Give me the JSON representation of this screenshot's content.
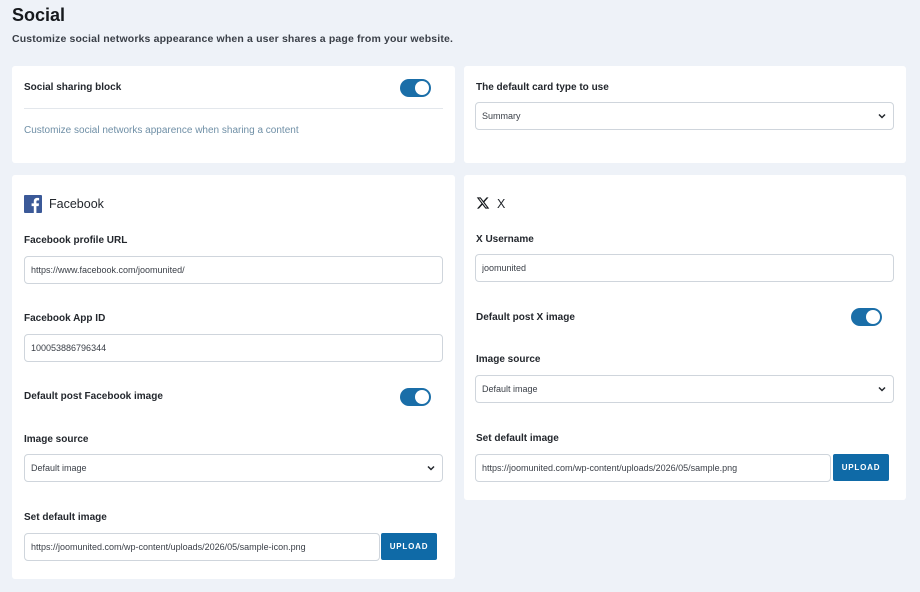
{
  "header": {
    "title": "Social",
    "subtitle": "Customize social networks appearance when a user shares a page from your website."
  },
  "sharing": {
    "label": "Social sharing block",
    "enabled": true,
    "hint": "Customize social networks apparence when sharing a content"
  },
  "card_type": {
    "label": "The default card type to use",
    "selected": "Summary"
  },
  "facebook": {
    "title": "Facebook",
    "profile_url_label": "Facebook profile URL",
    "profile_url_value": "https://www.facebook.com/joomunited/",
    "app_id_label": "Facebook App ID",
    "app_id_value": "100053886796344",
    "default_image_toggle_label": "Default post Facebook image",
    "default_image_enabled": true,
    "image_source_label": "Image source",
    "image_source_selected": "Default image",
    "set_default_image_label": "Set default image",
    "default_image_url": "https://joomunited.com/wp-content/uploads/2026/05/sample-icon.png",
    "upload_label": "UPLOAD"
  },
  "x": {
    "title": "X",
    "username_label": "X Username",
    "username_value": "joomunited",
    "default_image_toggle_label": "Default post X image",
    "default_image_enabled": true,
    "image_source_label": "Image source",
    "image_source_selected": "Default image",
    "set_default_image_label": "Set default image",
    "default_image_url": "https://joomunited.com/wp-content/uploads/2026/05/sample.png",
    "upload_label": "UPLOAD"
  },
  "colors": {
    "accent": "#0f6aa7",
    "facebook_brand": "#3b5998",
    "background": "#eef2f8"
  }
}
